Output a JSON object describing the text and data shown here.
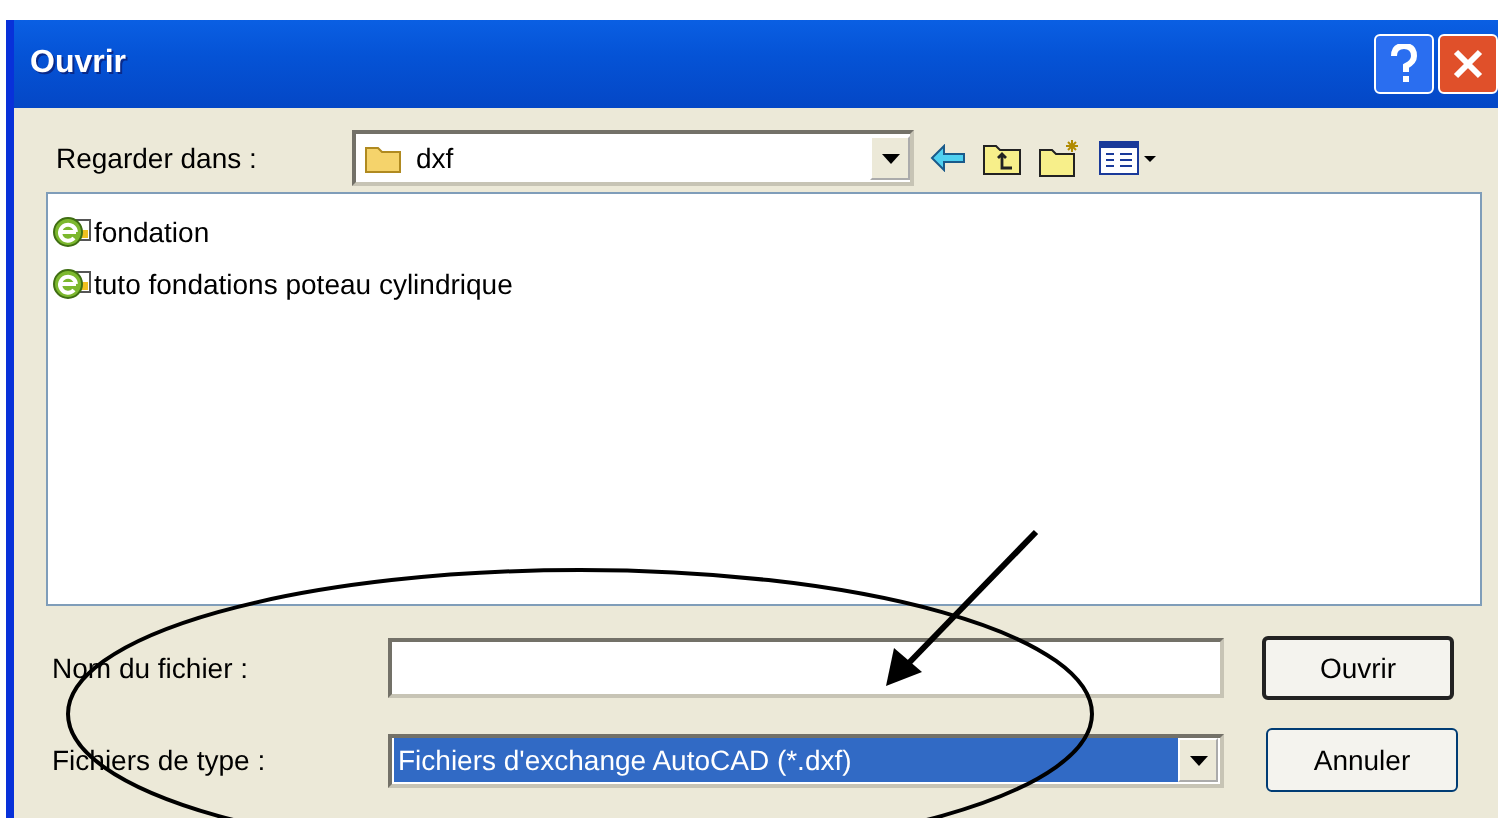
{
  "window": {
    "title": "Ouvrir"
  },
  "look_in": {
    "label": "Regarder dans :",
    "value": "dxf"
  },
  "files": [
    {
      "name": "fondation"
    },
    {
      "name": "tuto fondations poteau cylindrique"
    }
  ],
  "file_name": {
    "label": "Nom du fichier :"
  },
  "file_type": {
    "label": "Fichiers de type :",
    "value": "Fichiers d'exchange AutoCAD (*.dxf)"
  },
  "buttons": [
    {
      "label": "Ouvrir",
      "kind": "default"
    },
    {
      "label": "Annuler",
      "kind": "normal"
    }
  ]
}
